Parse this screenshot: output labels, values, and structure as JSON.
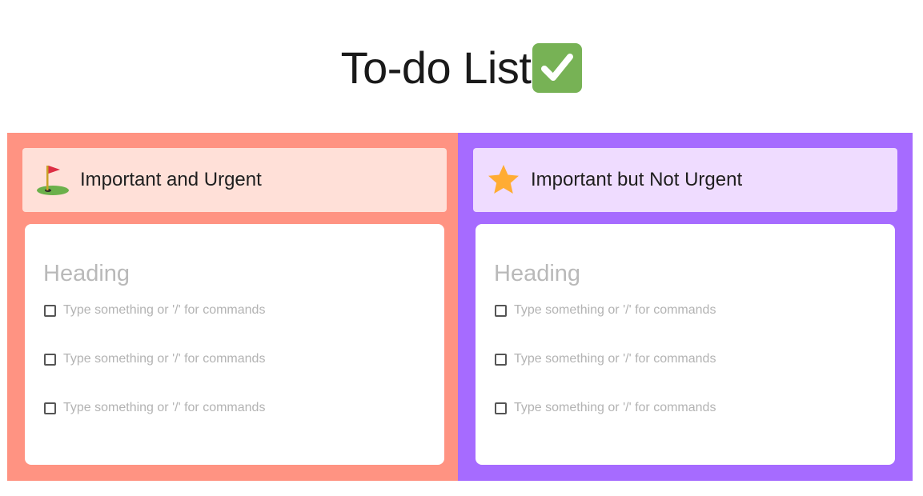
{
  "page": {
    "title": "To-do List",
    "title_icon": "check-mark-button-icon"
  },
  "colors": {
    "urgent_column": "#ff9382",
    "urgent_header": "#ffe0d8",
    "not_urgent_column": "#a66bff",
    "not_urgent_header": "#efdcff",
    "check_emoji": "#77b255"
  },
  "columns": [
    {
      "label": "Important and Urgent",
      "icon": "golf-flag-icon",
      "card": {
        "heading_placeholder": "Heading",
        "items": [
          {
            "placeholder": "Type something or '/' for commands",
            "checked": false
          },
          {
            "placeholder": "Type something or '/' for commands",
            "checked": false
          },
          {
            "placeholder": "Type something or '/' for commands",
            "checked": false
          }
        ]
      }
    },
    {
      "label": "Important but Not Urgent",
      "icon": "star-icon",
      "card": {
        "heading_placeholder": "Heading",
        "items": [
          {
            "placeholder": "Type something or '/' for commands",
            "checked": false
          },
          {
            "placeholder": "Type something or '/' for commands",
            "checked": false
          },
          {
            "placeholder": "Type something or '/' for commands",
            "checked": false
          }
        ]
      }
    }
  ]
}
